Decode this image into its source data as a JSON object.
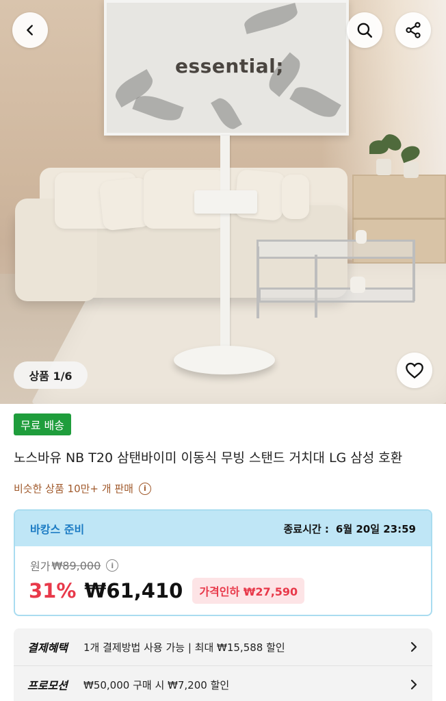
{
  "hero": {
    "tv_screen_text": "essential;",
    "image_counter": "상품 1/6"
  },
  "icons": {
    "back": "chevron-left-icon",
    "search": "search-icon",
    "share": "share-icon",
    "wishlist": "heart-icon"
  },
  "product": {
    "shipping_badge": "무료 배송",
    "title": "노스바유 NB T20 삼탠바이미 이동식 무빙 스탠드 거치대 LG 삼성 호환",
    "similar_sales": "비슷한 상품 10만+ 개 판매"
  },
  "deal": {
    "name": "바캉스 준비",
    "end_label": "종료시간 :",
    "end_time": "6월 20일 23:59",
    "original_label": "원가",
    "original_price": "₩89,000",
    "discount_percent": "31%",
    "sale_price": "₩61,410",
    "price_drop": "가격인하 ₩27,590"
  },
  "benefits": [
    {
      "label": "결제혜택",
      "text": "1개 결제방법 사용 가능 | 최대 ₩15,588 할인"
    },
    {
      "label": "프로모션",
      "text": "₩50,000 구매 시 ₩7,200 할인"
    }
  ],
  "colors": {
    "badge_green": "#1f9d3c",
    "discount_red": "#e8394a",
    "deal_blue": "#1d7cc4",
    "deal_header_bg": "#bfe6f6",
    "similar_brown": "#a0592b"
  }
}
